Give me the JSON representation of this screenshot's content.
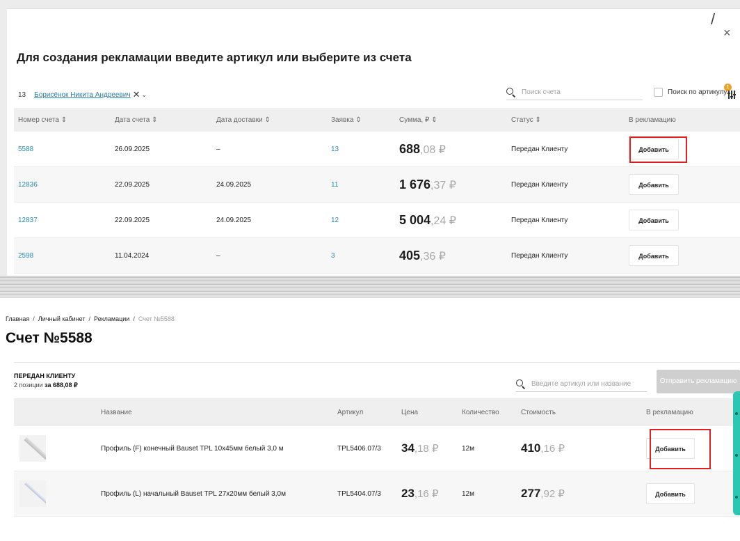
{
  "modal": {
    "corner_mark": "/",
    "close_label": "×",
    "title": "Для создания рекламации введите артикул или выберите из счета",
    "filter": {
      "count": "13",
      "chip_label": "Борисёнок Никита Андреевич",
      "chip_remove": "✕",
      "chip_caret": "⌄"
    },
    "search": {
      "placeholder": "Поиск счета"
    },
    "article_search_label": "Поиск по артикулу",
    "settings_badge": "1",
    "columns": [
      "Номер счета ⇕",
      "Дата счета ⇕",
      "Дата доставки ⇕",
      "Заявка ⇕",
      "Сумма, ₽ ⇕",
      "Статус ⇕",
      "В рекламацию"
    ],
    "rows": [
      {
        "number": "5588",
        "date": "26.09.2025",
        "delivery": "–",
        "order": "13",
        "sum_int": "688",
        "sum_frac": ",08 ₽",
        "status": "Передан Клиенту",
        "action": "Добавить",
        "highlighted": true
      },
      {
        "number": "12836",
        "date": "22.09.2025",
        "delivery": "24.09.2025",
        "order": "11",
        "sum_int": "1 676",
        "sum_frac": ",37 ₽",
        "status": "Передан Клиенту",
        "action": "Добавить",
        "highlighted": false
      },
      {
        "number": "12837",
        "date": "22.09.2025",
        "delivery": "24.09.2025",
        "order": "12",
        "sum_int": "5 004",
        "sum_frac": ",24 ₽",
        "status": "Передан Клиенту",
        "action": "Добавить",
        "highlighted": false
      },
      {
        "number": "2598",
        "date": "11.04.2024",
        "delivery": "–",
        "order": "3",
        "sum_int": "405",
        "sum_frac": ",36 ₽",
        "status": "Передан Клиенту",
        "action": "Добавить",
        "highlighted": false
      }
    ]
  },
  "page": {
    "breadcrumbs": [
      "Главная",
      "Личный кабинет",
      "Рекламации",
      "Счет №5588"
    ],
    "breadcrumb_sep": "/",
    "title": "Счет №5588",
    "status_title": "ПЕРЕДАН КЛИЕНТУ",
    "status_sub_prefix": "2 позиции ",
    "status_sub_amount": "за 688,08 ₽",
    "search": {
      "placeholder": "Введите артикул или название"
    },
    "send_button": "Отправить рекламацию",
    "columns": [
      "Название",
      "Артикул",
      "Цена",
      "Количество",
      "Стоимость",
      "В рекламацию"
    ],
    "products": [
      {
        "name": "Профиль (F) конечный Bauset TPL 10х45мм белый 3,0 м",
        "article": "TPL5406.07/3",
        "price_int": "34",
        "price_frac": ",18 ₽",
        "qty": "12м",
        "cost_int": "410",
        "cost_frac": ",16 ₽",
        "action": "Добавить",
        "highlighted": true
      },
      {
        "name": "Профиль (L) начальный Bauset TPL 27х20мм белый 3,0м",
        "article": "TPL5404.07/3",
        "price_int": "23",
        "price_frac": ",16 ₽",
        "qty": "12м",
        "cost_int": "277",
        "cost_frac": ",92 ₽",
        "action": "Добавить",
        "highlighted": false
      }
    ]
  },
  "colors": {
    "accent_link": "#2a8bb0",
    "highlight": "#e02020",
    "side_tab": "#2cc7b3",
    "disabled_button": "#cfcfcf"
  }
}
